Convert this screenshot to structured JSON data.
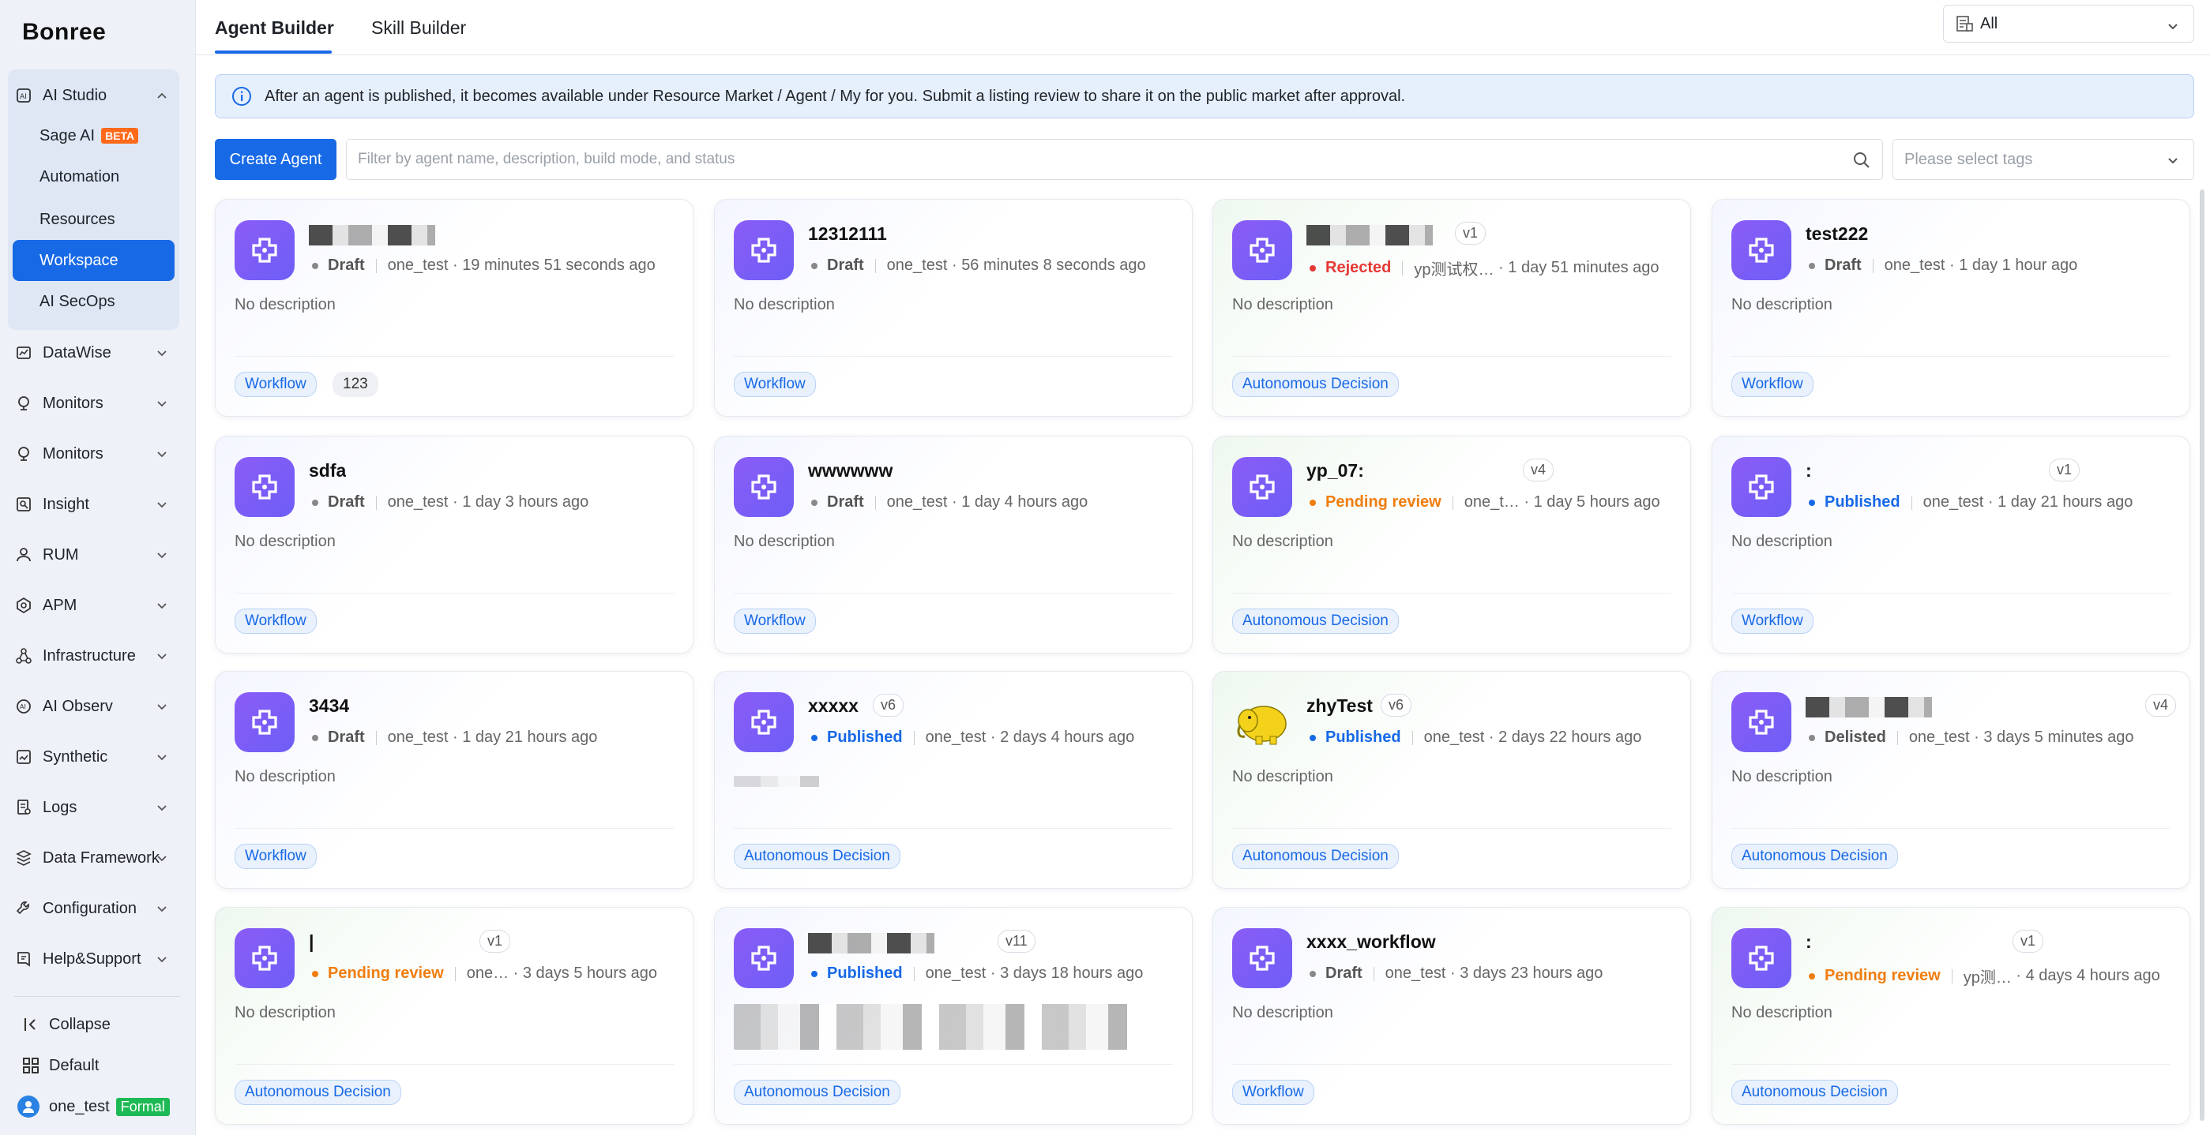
{
  "sidebar": {
    "brand": "Bonree",
    "groups": [
      {
        "label": "AI Studio",
        "icon": "ai-studio-icon"
      },
      {
        "label": "DataWise",
        "icon": "datawise-icon"
      },
      {
        "label": "Monitors",
        "icon": "monitors-icon"
      },
      {
        "label": "Monitors",
        "icon": "monitors-icon"
      },
      {
        "label": "Insight",
        "icon": "insight-icon"
      },
      {
        "label": "RUM",
        "icon": "rum-icon"
      },
      {
        "label": "APM",
        "icon": "apm-icon"
      },
      {
        "label": "Infrastructure",
        "icon": "infrastructure-icon"
      },
      {
        "label": "AI Observ",
        "icon": "ai-observ-icon"
      },
      {
        "label": "Synthetic",
        "icon": "synthetic-icon"
      },
      {
        "label": "Logs",
        "icon": "logs-icon"
      },
      {
        "label": "Data Framework",
        "icon": "data-framework-icon"
      },
      {
        "label": "Configuration",
        "icon": "configuration-icon"
      },
      {
        "label": "Help&Support",
        "icon": "help-support-icon"
      }
    ],
    "studio_items": [
      {
        "label": "Sage AI",
        "badge": "BETA"
      },
      {
        "label": "Automation"
      },
      {
        "label": "Resources"
      },
      {
        "label": "Workspace",
        "active": true
      },
      {
        "label": "AI SecOps"
      }
    ],
    "collapse_label": "Collapse",
    "default_label": "Default",
    "user_name": "one_test",
    "user_badge": "Formal"
  },
  "tabs": [
    {
      "label": "Agent Builder",
      "active": true
    },
    {
      "label": "Skill Builder"
    }
  ],
  "scope_select": {
    "value": "All"
  },
  "banner": {
    "text": "After an agent is published, it becomes available under Resource Market / Agent / My for you. Submit a listing review to share it on the public market after approval."
  },
  "toolbar": {
    "create_label": "Create Agent",
    "search_placeholder": "Filter by agent name, description, build mode, and status",
    "tags_placeholder": "Please select tags"
  },
  "cards": [
    {
      "title": "",
      "redacted": true,
      "version": "",
      "status": "Draft",
      "status_class": "draft",
      "owner": "one_test",
      "time": "19 minutes 51 seconds ago",
      "desc": "No description",
      "tags": [
        "Workflow",
        "123"
      ],
      "tone": "p"
    },
    {
      "title": "12312111",
      "version": "",
      "status": "Draft",
      "status_class": "draft",
      "owner": "one_test",
      "time": "56 minutes 8 seconds ago",
      "desc": "No description",
      "tags": [
        "Workflow"
      ],
      "tone": "p"
    },
    {
      "title": "",
      "redacted": true,
      "version": "v1",
      "status": "Rejected",
      "status_class": "rejected",
      "owner": "yp测试权…",
      "time": "1 day 51 minutes ago",
      "desc": "No description",
      "tags": [
        "Autonomous Decision"
      ],
      "tone": "g"
    },
    {
      "title": "test222",
      "version": "",
      "status": "Draft",
      "status_class": "draft",
      "owner": "one_test",
      "time": "1 day 1 hour ago",
      "desc": "No description",
      "tags": [
        "Workflow"
      ],
      "tone": "p"
    },
    {
      "title": "sdfa",
      "version": "",
      "status": "Draft",
      "status_class": "draft",
      "owner": "one_test",
      "time": "1 day 3 hours ago",
      "desc": "No description",
      "tags": [
        "Workflow"
      ],
      "tone": "p"
    },
    {
      "title": "wwwwww",
      "version": "",
      "status": "Draft",
      "status_class": "draft",
      "owner": "one_test",
      "time": "1 day 4 hours ago",
      "desc": "No description",
      "tags": [
        "Workflow"
      ],
      "tone": "p"
    },
    {
      "title": "yp_07:",
      "version": "v4",
      "status": "Pending review",
      "status_class": "pending",
      "owner": "one_t…",
      "time": "1 day 5 hours ago",
      "desc": "No description",
      "tags": [
        "Autonomous Decision"
      ],
      "tone": "g"
    },
    {
      "title": ":",
      "version": "v1",
      "status": "Published",
      "status_class": "published",
      "owner": "one_test",
      "time": "1 day 21 hours ago",
      "desc": "No description",
      "tags": [
        "Workflow"
      ],
      "tone": "p"
    },
    {
      "title": "3434",
      "version": "",
      "status": "Draft",
      "status_class": "draft",
      "owner": "one_test",
      "time": "1 day 21 hours ago",
      "desc": "No description",
      "tags": [
        "Workflow"
      ],
      "tone": "p"
    },
    {
      "title": "xxxxx",
      "version": "v6",
      "status": "Published",
      "status_class": "published",
      "owner": "one_test",
      "time": "2 days 4 hours ago",
      "desc": "",
      "desc_blur": "small",
      "tags": [
        "Autonomous Decision"
      ],
      "tone": "p"
    },
    {
      "title": "zhyTest",
      "version": "v6",
      "status": "Published",
      "status_class": "published",
      "owner": "one_test",
      "time": "2 days 22 hours ago",
      "desc": "No description",
      "tags": [
        "Autonomous Decision"
      ],
      "tone": "g",
      "elephant": true
    },
    {
      "title": "",
      "redacted": true,
      "version": "v4",
      "status": "Delisted",
      "status_class": "delisted",
      "owner": "one_test",
      "time": "3 days 5 minutes ago",
      "desc": "No description",
      "tags": [
        "Autonomous Decision"
      ],
      "tone": "p"
    },
    {
      "title": "|",
      "version": "v1",
      "status": "Pending review",
      "status_class": "pending",
      "owner": "one…",
      "time": "3 days 5 hours ago",
      "desc": "No description",
      "tags": [
        "Autonomous Decision"
      ],
      "tone": "g"
    },
    {
      "title": "",
      "redacted": true,
      "version": "v11",
      "status": "Published",
      "status_class": "published",
      "owner": "one_test",
      "time": "3 days 18 hours ago",
      "desc": "",
      "desc_blur": "large",
      "tags": [
        "Autonomous Decision"
      ],
      "tone": "p"
    },
    {
      "title": "xxxx_workflow",
      "version": "",
      "status": "Draft",
      "status_class": "draft",
      "owner": "one_test",
      "time": "3 days 23 hours ago",
      "desc": "No description",
      "tags": [
        "Workflow"
      ],
      "tone": "p"
    },
    {
      "title": ":",
      "version": "v1",
      "status": "Pending review",
      "status_class": "pending",
      "owner": "yp测…",
      "time": "4 days 4 hours ago",
      "desc": "No description",
      "tags": [
        "Autonomous Decision"
      ],
      "tone": "g"
    }
  ],
  "colors": {
    "accent": "#1769e6",
    "pending": "#f07d0f",
    "rejected": "#e53935",
    "agent_icon": "#7c5cf6"
  }
}
